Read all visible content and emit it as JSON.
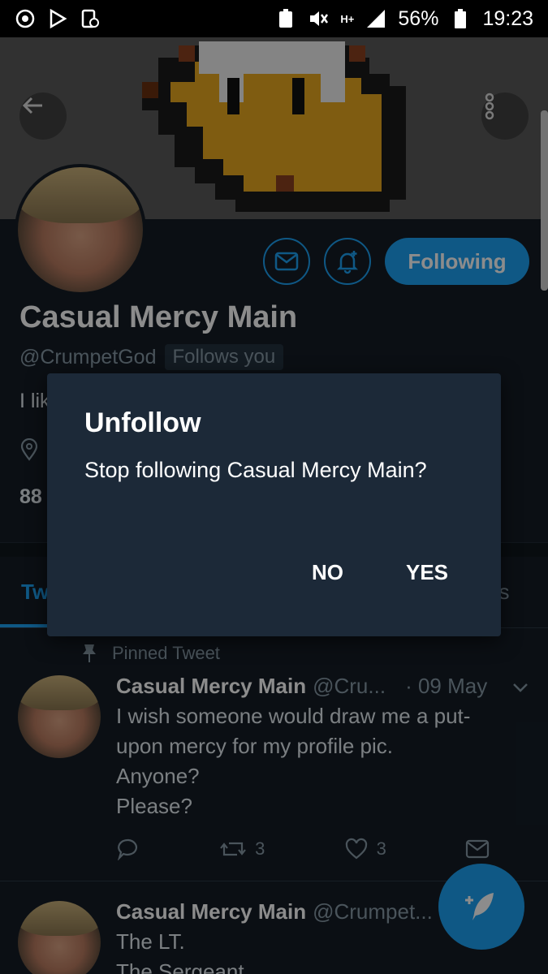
{
  "status_bar": {
    "signal_label": "H+",
    "battery": "56%",
    "time": "19:23"
  },
  "profile": {
    "name": "Casual Mercy Main",
    "handle": "@CrumpetGod",
    "follows_you": "Follows you",
    "bio_partial": "I lik",
    "count_partial": "88",
    "following_label": "Following"
  },
  "tabs": {
    "left_partial": "Tw",
    "right_partial": "es"
  },
  "tweets": [
    {
      "pinned_label": "Pinned Tweet",
      "name": "Casual Mercy Main",
      "handle": "@Cru...",
      "time": "· 09 May",
      "lines": [
        "I wish someone would draw me a put-",
        "upon mercy for my profile pic.",
        "Anyone?",
        "Please?"
      ],
      "retweets": "3",
      "likes": "3"
    },
    {
      "name": "Casual Mercy Main",
      "handle": "@Crumpet...",
      "lines": [
        "The LT.",
        "The Sergeant"
      ]
    }
  ],
  "dialog": {
    "title": "Unfollow",
    "message": "Stop following Casual Mercy Main?",
    "no_label": "NO",
    "yes_label": "YES"
  },
  "colors": {
    "accent": "#1da1f2",
    "background": "#141d26",
    "dialog": "#1c2938"
  }
}
